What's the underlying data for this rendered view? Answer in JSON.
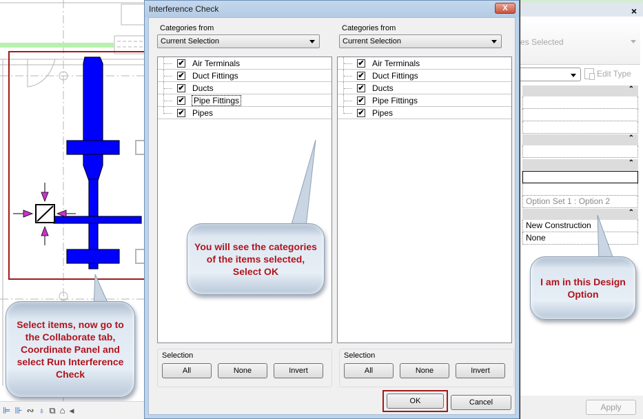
{
  "canvas": {
    "status_icons": [
      "thin-lines-icon",
      "reveal-hidden-icon",
      "temporary-hide-icon",
      "bulb-icon",
      "crop-view-icon",
      "worksets-icon",
      "scroll-left-icon"
    ]
  },
  "dialog": {
    "title": "Interference Check",
    "close_label": "X",
    "left": {
      "categories_from_label": "Categories from",
      "categories_from_value": "Current Selection",
      "items": [
        {
          "label": "Air Terminals",
          "checked": true
        },
        {
          "label": "Duct Fittings",
          "checked": true
        },
        {
          "label": "Ducts",
          "checked": true
        },
        {
          "label": "Pipe Fittings",
          "checked": true,
          "focused": true
        },
        {
          "label": "Pipes",
          "checked": true
        }
      ],
      "selection_label": "Selection",
      "buttons": {
        "all": "All",
        "none": "None",
        "invert": "Invert"
      }
    },
    "right": {
      "categories_from_label": "Categories from",
      "categories_from_value": "Current Selection",
      "items": [
        {
          "label": "Air Terminals",
          "checked": true
        },
        {
          "label": "Duct Fittings",
          "checked": true
        },
        {
          "label": "Ducts",
          "checked": true
        },
        {
          "label": "Pipe Fittings",
          "checked": true
        },
        {
          "label": "Pipes",
          "checked": true
        }
      ],
      "selection_label": "Selection",
      "buttons": {
        "all": "All",
        "none": "None",
        "invert": "Invert"
      }
    },
    "ok_label": "OK",
    "cancel_label": "Cancel",
    "checkmark": "✔"
  },
  "properties": {
    "close_label": "×",
    "type_selector_text": "es Selected",
    "edit_type_label": "Edit Type",
    "collapse_glyph": "⌃",
    "design_option_value": "Option Set 1 : Option 2",
    "phase_created_value": "New Construction",
    "phase_demolished_value": "None",
    "apply_label": "Apply"
  },
  "callouts": {
    "canvas_note": "Select items, now go to the Collaborate tab, Coordinate Panel and select Run Interference Check",
    "dialog_note": "You will see the categories of the items selected, Select OK",
    "props_note": "I am in this Design Option"
  },
  "colors": {
    "callout_text": "#b0141c",
    "highlight_border": "#a11a1a",
    "duct_blue": "#0000ff",
    "grip_magenta": "#cc33cc"
  }
}
